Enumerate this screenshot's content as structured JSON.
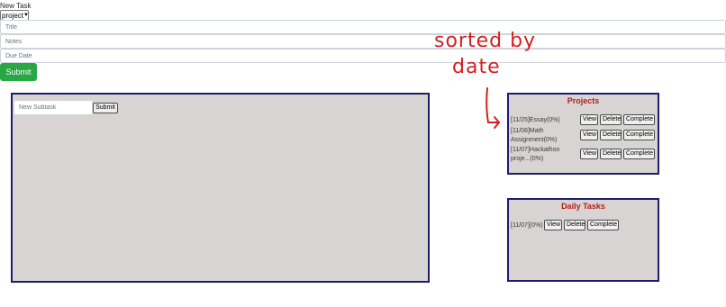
{
  "form": {
    "heading": "New Task",
    "type_selected": "project",
    "title_placeholder": "Title",
    "notes_placeholder": "Notes",
    "due_placeholder": "Due Date",
    "submit_label": "Submit"
  },
  "subtask_panel": {
    "input_placeholder": "New Subtask",
    "submit_label": "Submit"
  },
  "projects": {
    "title": "Projects",
    "items": [
      {
        "label": "[11/25]Essay(0%)",
        "view": "View",
        "delete": "Delete",
        "complete": "Complete"
      },
      {
        "label": "[11/08]Math Assignment(0%)",
        "view": "View",
        "delete": "Delete",
        "complete": "Complete"
      },
      {
        "label": "[11/07]Hackathon proje...(0%)",
        "view": "View",
        "delete": "Delete",
        "complete": "Complete"
      }
    ]
  },
  "daily": {
    "title": "Daily Tasks",
    "items": [
      {
        "label": "[11/07](0%)",
        "view": "View",
        "delete": "Delete",
        "complete": "Complete"
      }
    ]
  },
  "annotation": {
    "line1": "sorted by",
    "line2": "date"
  },
  "colors": {
    "accent_green": "#28a745",
    "panel_bg": "#d8d4d4",
    "panel_border": "#1f1d6b",
    "panel_title": "#b41e1e",
    "annotation_red": "#d42020"
  }
}
